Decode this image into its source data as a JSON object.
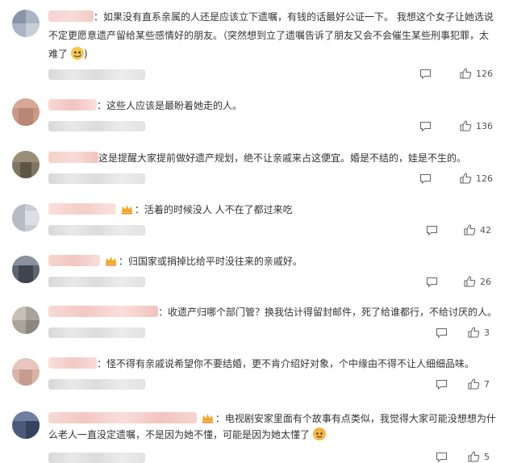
{
  "colors": {
    "accent": "#f5a623",
    "muted": "#555555",
    "text": "#333333",
    "blur": "#f3c9c4"
  },
  "icons": {
    "reply": "chat-bubble-icon",
    "like": "thumbs-up-icon",
    "badge": "crown-badge-icon",
    "emoji": "emoji-icon"
  },
  "comments": [
    {
      "lines": [
        "：如果没有直系亲属的人还是应该立下遗嘱，有钱的话最好公证一下。 我想这个女子让她选说",
        "不定更愿意遗产留给某些感情好的朋友。（突然想到立了遗嘱告诉了朋友又会不会催生某些刑事犯罪，太",
        "难了"
      ],
      "trailing": ")",
      "likes": "126"
    },
    {
      "lines": [
        "：这些人应该是最盼着她走的人。"
      ],
      "likes": "136"
    },
    {
      "lines": [
        "这是提醒大家提前做好遗产规划，绝不让亲戚来占这便宜。婚是不结的，娃是不生的。"
      ],
      "likes": "126"
    },
    {
      "lines": [
        "：活着的时候没人 人不在了都过来吃"
      ],
      "likes": "42"
    },
    {
      "lines": [
        "：归国家或捐掉比给平时没往来的亲戚好。"
      ],
      "likes": "26"
    },
    {
      "lines": [
        "：收遗产归哪个部门管？换我估计得留封邮件，死了给谁都行，不给讨厌的人。"
      ],
      "likes": "3"
    },
    {
      "lines": [
        "：怪不得有亲戚说希望你不要结婚，更不肯介绍好对象，个中缘由不得不让人细细品味。"
      ],
      "likes": "7"
    },
    {
      "lines": [
        "：电视剧安家里面有个故事有点类似，我觉得大家可能没想想为什",
        "么老人一直没定遗嘱，不是因为她不懂，可能是因为她太懂了"
      ],
      "likes": "5"
    }
  ]
}
